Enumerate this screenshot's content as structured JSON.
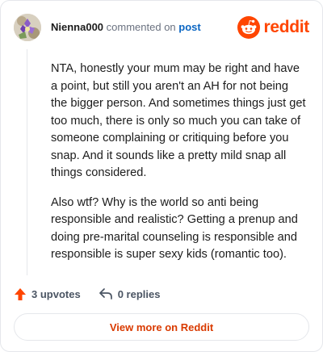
{
  "header": {
    "username": "Nienna000",
    "verb": "commented on",
    "post_link": "post",
    "brand_wordmark": "reddit"
  },
  "comment": {
    "paragraphs": [
      "NTA, honestly your mum may be right and have a point, but still you aren't an AH for not being the bigger person. And sometimes things just get too much, there is only so much you can take of someone complaining or critiquing before you snap. And it sounds like a pretty mild snap all things considered.",
      "Also wtf? Why is the world so anti being responsible and realistic? Getting a prenup and doing pre-marital counseling is responsible and responsible is super sexy kids (romantic too)."
    ]
  },
  "actions": {
    "upvotes": "3 upvotes",
    "replies": "0 replies"
  },
  "footer": {
    "view_more": "View more on Reddit"
  },
  "colors": {
    "brand": "#ff4500",
    "link": "#0b66c3",
    "view_more": "#d93a00"
  },
  "icons": [
    "avatar-image",
    "reddit-logo-icon",
    "upvote-arrow-icon",
    "reply-icon"
  ]
}
